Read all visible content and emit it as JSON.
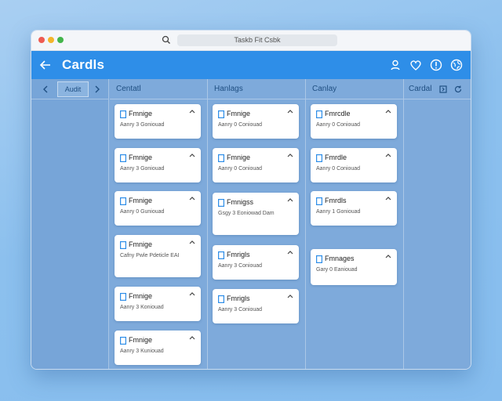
{
  "browser": {
    "url_text": "Taskb Fit Csbk"
  },
  "appbar": {
    "title": "Cardls",
    "actions": [
      "user-icon",
      "heart-icon",
      "info-icon",
      "globe-icon"
    ],
    "accent": "#2e8ee8"
  },
  "sidebar": {
    "tab_label": "Audit"
  },
  "columns": [
    {
      "header": "Centatl",
      "cards": [
        {
          "title": "Fmnige",
          "sub": "Aanry 3 Goniouad"
        },
        {
          "title": "Fmnige",
          "sub": "Aanry 3 Goniouad"
        },
        {
          "title": "Fmnige",
          "sub": "Aanry 0 Guniouad"
        },
        {
          "title": "Fmnige",
          "sub": "Cafny Pwle Pdeticle EAI"
        },
        {
          "title": "Fmnige",
          "sub": "Aanry 3 Koniouad"
        },
        {
          "title": "Fmnige",
          "sub": "Aanry 3 Kuniouad"
        }
      ]
    },
    {
      "header": "Hanlags",
      "cards": [
        {
          "title": "Fmnige",
          "sub": "Aanry 0 Coniouad"
        },
        {
          "title": "Fmnige",
          "sub": "Aanry 0 Coniouad"
        },
        {
          "title": "Fmnigss",
          "sub": "Gsgy 3 Eoniowad Dam"
        },
        {
          "title": "Fmrigls",
          "sub": "Aanry 3 Coniouad"
        },
        {
          "title": "Fmrigls",
          "sub": "Aanry 3 Coniouad"
        }
      ]
    },
    {
      "header": "Canlay",
      "cards": [
        {
          "title": "Fmrcdle",
          "sub": "Aanry 0 Coniouad"
        },
        {
          "title": "Fmrdle",
          "sub": "Aanry 0 Coniouad"
        },
        {
          "title": "Fmrdls",
          "sub": "Aanry 1 Goniouad"
        },
        {
          "title": "Fmnages",
          "sub": "Gary 0 Eaniouad"
        }
      ]
    },
    {
      "header": "Cardal",
      "cards": []
    }
  ]
}
